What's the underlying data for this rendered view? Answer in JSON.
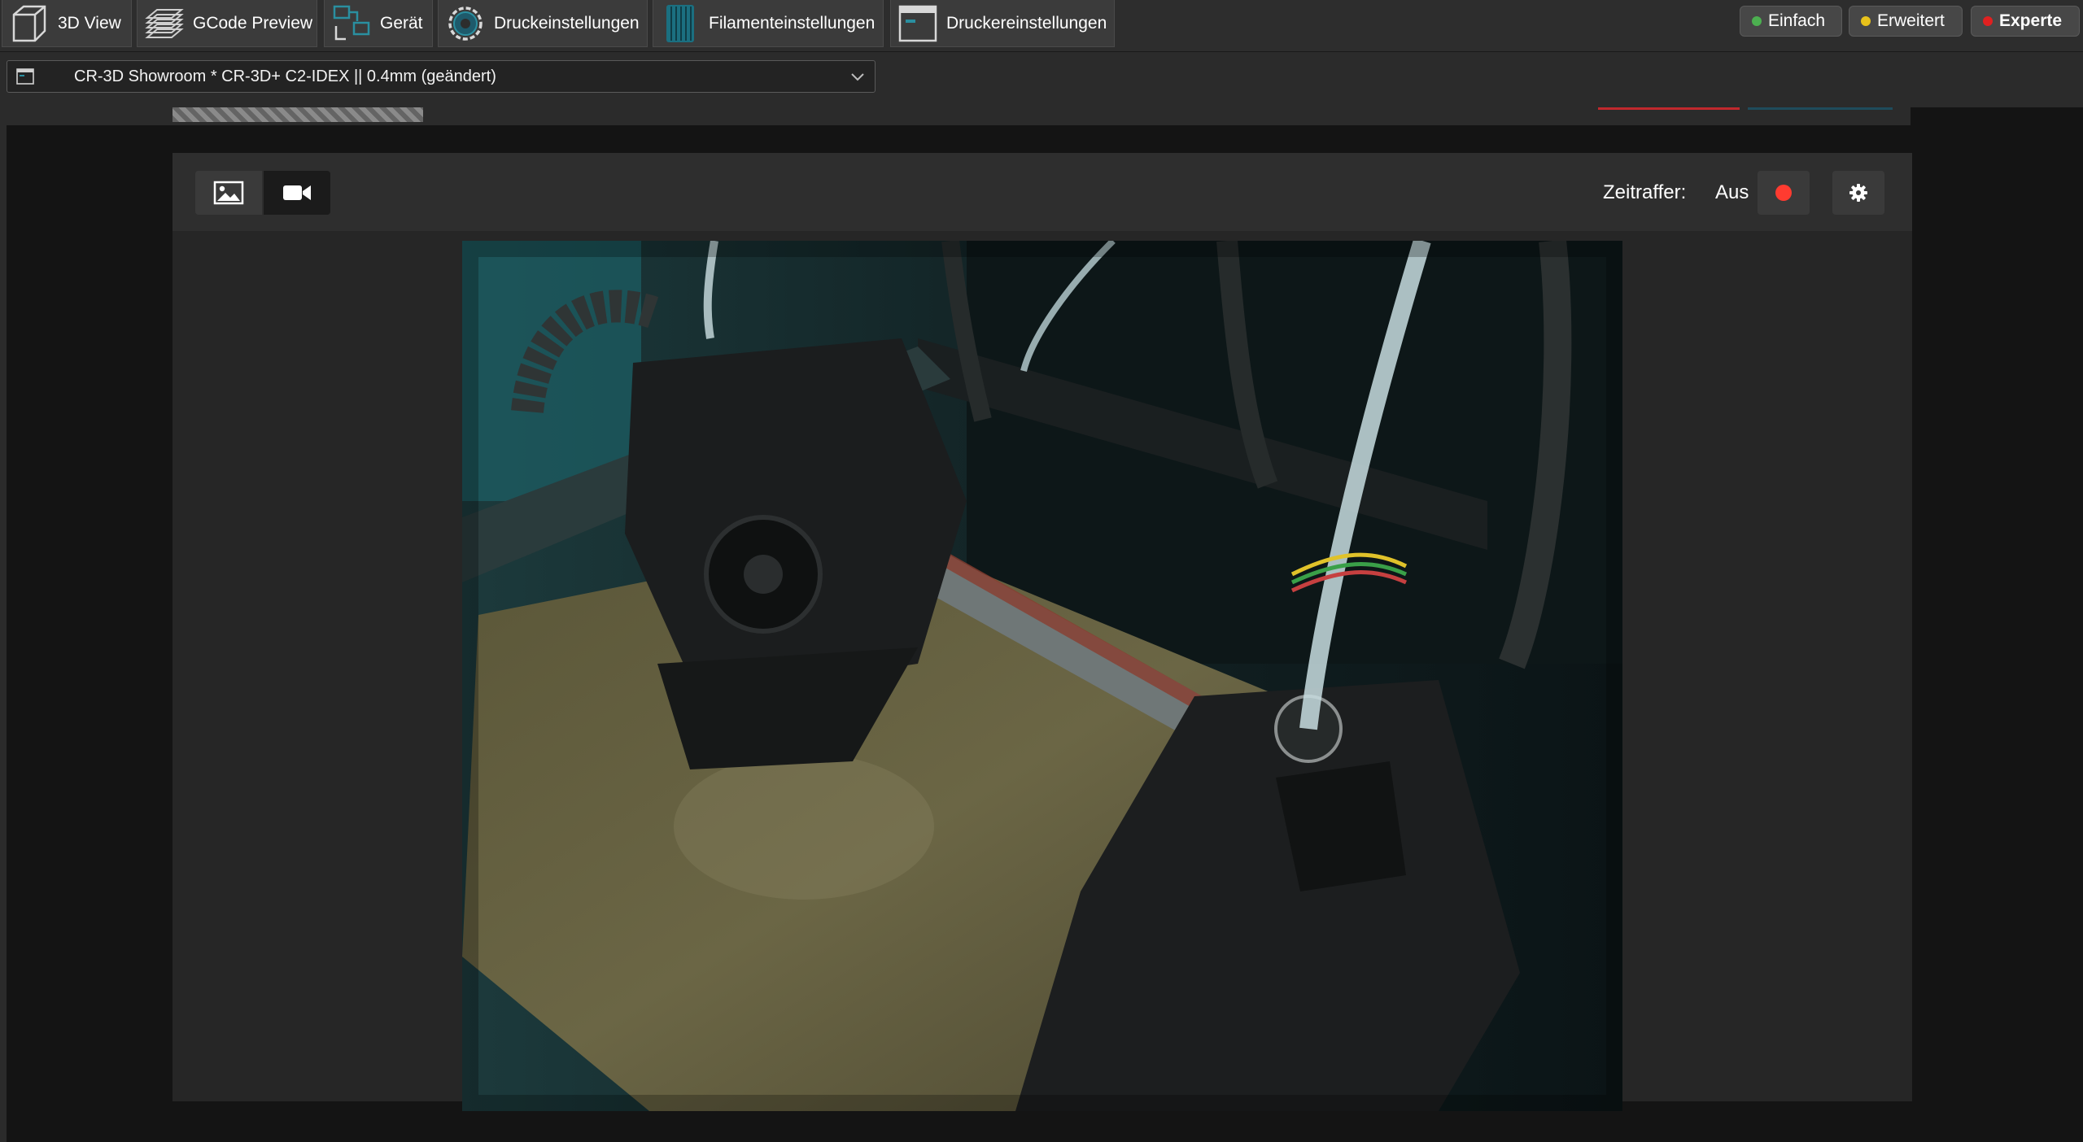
{
  "toolbar": {
    "tabs": [
      {
        "label": "3D View",
        "icon": "cube-icon"
      },
      {
        "label": "GCode Preview",
        "icon": "layers-icon"
      },
      {
        "label": "Gerät",
        "icon": "device-icon"
      },
      {
        "label": "Druckeinstellungen",
        "icon": "gear-icon"
      },
      {
        "label": "Filamenteinstellungen",
        "icon": "filament-spool-icon"
      },
      {
        "label": "Druckereinstellungen",
        "icon": "printer-window-icon"
      }
    ],
    "modes": [
      {
        "label": "Einfach",
        "color": "#4caf50"
      },
      {
        "label": "Erweitert",
        "color": "#e8c21b"
      },
      {
        "label": "Experte",
        "color": "#e02020"
      }
    ]
  },
  "preset": {
    "label": "CR-3D Showroom * CR-3D+ C2-IDEX || 0.4mm (geändert)",
    "icon": "printer-preset-icon"
  },
  "camera": {
    "snapshot_icon": "image-icon",
    "video_icon": "video-camera-icon",
    "timelapse_label": "Zeitraffer:",
    "timelapse_status": "Aus",
    "record_icon": "record-icon",
    "settings_icon": "gear-icon",
    "record_color": "#ff3b30"
  }
}
